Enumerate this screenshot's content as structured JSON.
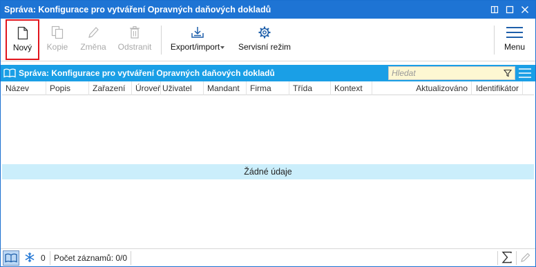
{
  "window": {
    "title": "Správa: Konfigurace pro vytváření Opravných daňových dokladů"
  },
  "toolbar": {
    "new_label": "Nový",
    "copy_label": "Kopie",
    "edit_label": "Změna",
    "delete_label": "Odstranit",
    "export_label": "Export/import",
    "service_label": "Servisní režim",
    "menu_label": "Menu"
  },
  "grid": {
    "title": "Správa: Konfigurace pro vytváření Opravných daňových dokladů",
    "search_placeholder": "Hledat",
    "columns": [
      "Název",
      "Popis",
      "Zařazení",
      "Úroveň",
      "Uživatel",
      "Mandant",
      "Firma",
      "Třída",
      "Kontext",
      "Aktualizováno",
      "Identifikátor"
    ],
    "empty_text": "Žádné údaje"
  },
  "status": {
    "filter_count": "0",
    "records_text": "Počet záznamů: 0/0"
  },
  "colors": {
    "titlebar": "#1e74d4",
    "grid_header": "#1a9fe6",
    "empty_row": "#cbeefb",
    "search_bg": "#fdf7d2",
    "highlight_border": "#e1141c"
  },
  "icons": {
    "new": "new-document-icon",
    "copy": "copy-icon",
    "edit": "pencil-icon",
    "delete": "trash-icon",
    "export": "export-import-icon",
    "service": "gear-icon",
    "menu": "hamburger-icon"
  }
}
